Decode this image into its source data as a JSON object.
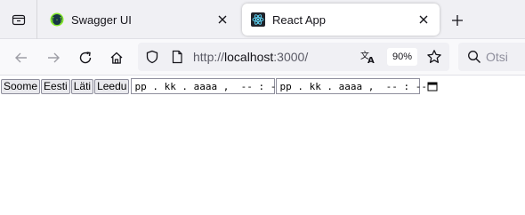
{
  "browser": {
    "tabs": [
      {
        "title": "Swagger UI",
        "active": false,
        "favicon": "swagger-icon",
        "favicon_color": "#85ea2d"
      },
      {
        "title": "React App",
        "active": true,
        "favicon": "react-icon",
        "favicon_color": "#61dafb"
      }
    ],
    "url": {
      "scheme": "http://",
      "host": "localhost",
      "rest": ":3000/"
    },
    "zoom": "90%",
    "search_placeholder": "Otsi"
  },
  "page": {
    "language_buttons": [
      "Soome",
      "Eesti",
      "Läti",
      "Leedu"
    ],
    "datetime_inputs": [
      {
        "placeholder": "pp . kk . aaaa ,  -- : --"
      },
      {
        "placeholder": "pp . kk . aaaa ,  -- : --"
      }
    ]
  },
  "colors": {
    "accent": "#0061e0"
  }
}
